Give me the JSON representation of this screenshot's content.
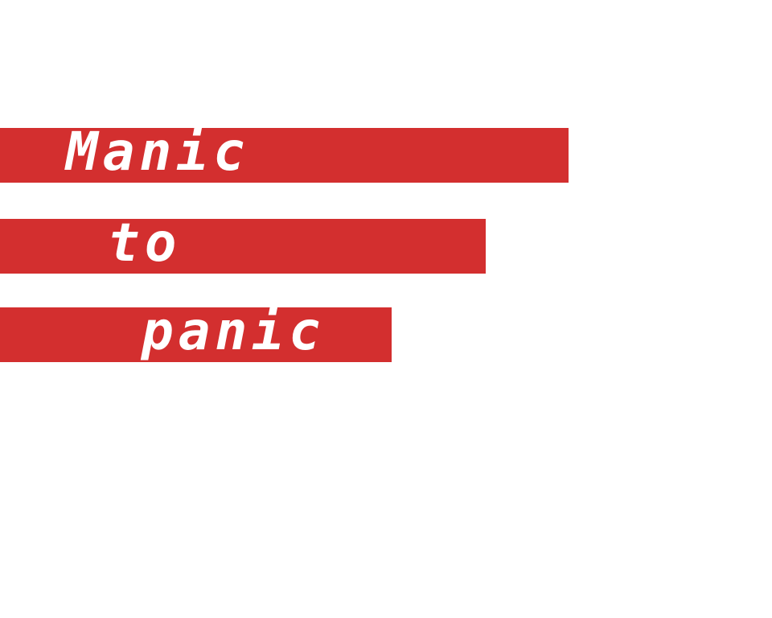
{
  "lines": [
    {
      "text": "Manic"
    },
    {
      "text": "to"
    },
    {
      "text": "panic"
    }
  ],
  "colors": {
    "band": "#d32f2f",
    "text": "#ffffff",
    "background": "#ffffff"
  }
}
